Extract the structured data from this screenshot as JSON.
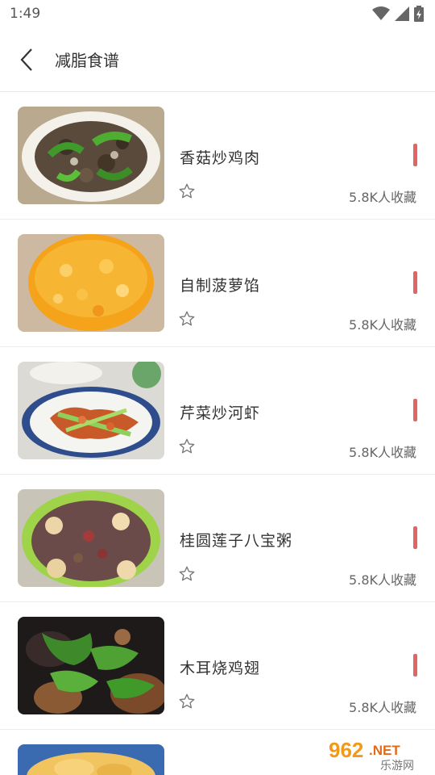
{
  "status": {
    "time": "1:49"
  },
  "header": {
    "title": "减脂食谱"
  },
  "recipes": [
    {
      "name": "香菇炒鸡肉",
      "favorites": "5.8K人收藏"
    },
    {
      "name": "自制菠萝馅",
      "favorites": "5.8K人收藏"
    },
    {
      "name": "芹菜炒河虾",
      "favorites": "5.8K人收藏"
    },
    {
      "name": "桂圆莲子八宝粥",
      "favorites": "5.8K人收藏"
    },
    {
      "name": "木耳烧鸡翅",
      "favorites": "5.8K人收藏"
    }
  ],
  "watermark": {
    "number": "962",
    "suffix": ".NET",
    "site": "乐游网"
  },
  "colors": {
    "accent_bar": "#e06666",
    "divider": "#ececec"
  }
}
